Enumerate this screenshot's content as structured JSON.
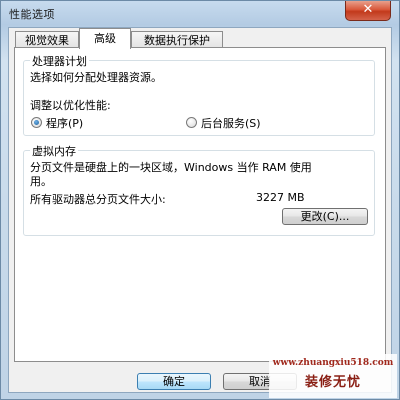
{
  "window": {
    "title": "性能选项",
    "close_glyph": "✕"
  },
  "tabs": [
    {
      "label": "视觉效果",
      "active": false
    },
    {
      "label": "高级",
      "active": true
    },
    {
      "label": "数据执行保护",
      "active": false
    }
  ],
  "processor": {
    "title": "处理器计划",
    "description": "选择如何分配处理器资源。",
    "optimize_label": "调整以优化性能:",
    "options": [
      {
        "label": "程序(P)",
        "checked": true
      },
      {
        "label": "后台服务(S)",
        "checked": false
      }
    ]
  },
  "virtual_memory": {
    "title": "虚拟内存",
    "description_line1": "分页文件是硬盘上的一块区域，Windows 当作 RAM 使用",
    "description_line2": "用。",
    "total_label": "所有驱动器总分页文件大小:",
    "total_value": "3227 MB",
    "change_button": "更改(C)..."
  },
  "footer": {
    "ok_button": "确定",
    "cancel_button": "取消"
  },
  "watermark": {
    "url": "www.zhuangxiu518.com",
    "name": "装修无忧"
  }
}
